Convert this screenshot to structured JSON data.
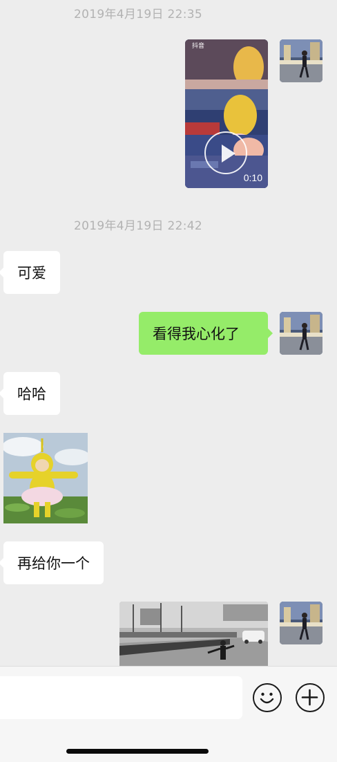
{
  "chat": {
    "timestamps": [
      "2019年4月19日 22:35",
      "2019年4月19日 22:42"
    ],
    "video": {
      "duration": "0:10",
      "source_label": "抖音"
    },
    "messages": [
      {
        "side": "left",
        "text": "可爱"
      },
      {
        "side": "right",
        "text": "看得我心化了"
      },
      {
        "side": "left",
        "text": "哈哈"
      },
      {
        "side": "left",
        "text": "再给你一个"
      }
    ]
  },
  "input_bar": {
    "value": "",
    "emoji_icon": "emoji-icon",
    "plus_icon": "plus-icon"
  },
  "colors": {
    "background": "#ededed",
    "outgoing_bubble": "#95ec69",
    "incoming_bubble": "#ffffff",
    "timestamp_text": "#b2b2b2"
  }
}
